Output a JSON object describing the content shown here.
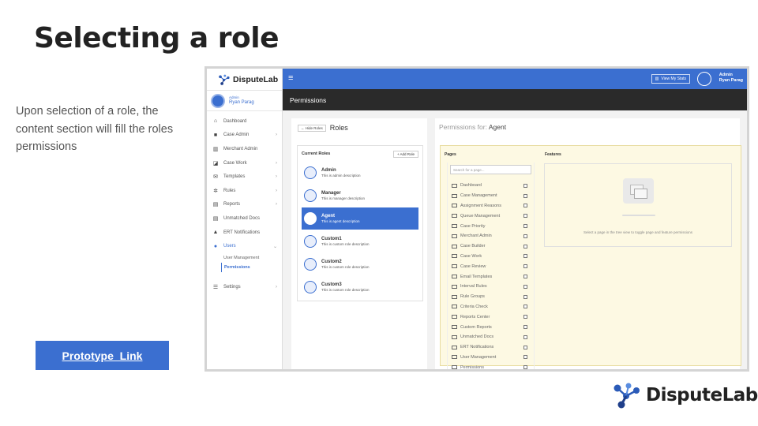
{
  "slide": {
    "title": "Selecting a role",
    "description": "Upon selection of a role, the content section will fill the roles permissions",
    "prototype_link": "Prototype_Link",
    "brand": "DisputeLab"
  },
  "colors": {
    "accent": "#3b6fd0",
    "header": "#2a2a2a",
    "highlight": "#fdf9e3"
  },
  "app": {
    "logo_text": "DisputeLab",
    "user_role": "Admin",
    "user_name": "Ryan Parag",
    "top_user_role": "Admin",
    "top_user_name": "Ryan Parag",
    "stats_button": "View My Stats",
    "page_header": "Permissions",
    "sidebar": [
      {
        "label": "Dashboard",
        "icon": "home-icon",
        "chevron": false
      },
      {
        "label": "Case Admin",
        "icon": "briefcase-icon",
        "chevron": true
      },
      {
        "label": "Merchant Admin",
        "icon": "building-icon",
        "chevron": false
      },
      {
        "label": "Case Work",
        "icon": "edit-icon",
        "chevron": true
      },
      {
        "label": "Templates",
        "icon": "envelope-icon",
        "chevron": true
      },
      {
        "label": "Rules",
        "icon": "gear-icon",
        "chevron": true
      },
      {
        "label": "Reports",
        "icon": "file-icon",
        "chevron": true
      },
      {
        "label": "Unmatched Docs",
        "icon": "file-icon",
        "chevron": false
      },
      {
        "label": "ERT Notifications",
        "icon": "warning-icon",
        "chevron": false
      },
      {
        "label": "Users",
        "icon": "users-icon",
        "chevron": true
      }
    ],
    "users_sub": [
      "User Management",
      "Permissions"
    ],
    "settings_label": "Settings",
    "roles": {
      "hide_button": "Hide Roles",
      "title": "Roles",
      "current_label": "Current Roles",
      "add_button": "Add Role",
      "items": [
        {
          "name": "Admin",
          "desc": "This is admin description"
        },
        {
          "name": "Manager",
          "desc": "This is manager description"
        },
        {
          "name": "Agent",
          "desc": "This is agent description"
        },
        {
          "name": "Custom1",
          "desc": "This is custom role description"
        },
        {
          "name": "Custom2",
          "desc": "This is custom role description"
        },
        {
          "name": "Custom3",
          "desc": "This is custom role description"
        }
      ],
      "selected": "Agent"
    },
    "permissions": {
      "heading_prefix": "Permissions for:",
      "heading_role": "Agent",
      "pages_label": "Pages",
      "features_label": "Features",
      "search_placeholder": "Search for a page...",
      "pages": [
        "Dashboard",
        "Case Management",
        "Assignment Reasons",
        "Queue Management",
        "Case Priority",
        "Merchant Admin",
        "Case Builder",
        "Case Work",
        "Case Review",
        "Email Templates",
        "Interval Rules",
        "Rule Groups",
        "Criteria Check",
        "Reports Center",
        "Custom Reports",
        "Unmatched Docs",
        "ERT Notifications",
        "User Management",
        "Permissions"
      ],
      "features_empty": "Select a page in the tree view to toggle page and feature permissions"
    }
  }
}
